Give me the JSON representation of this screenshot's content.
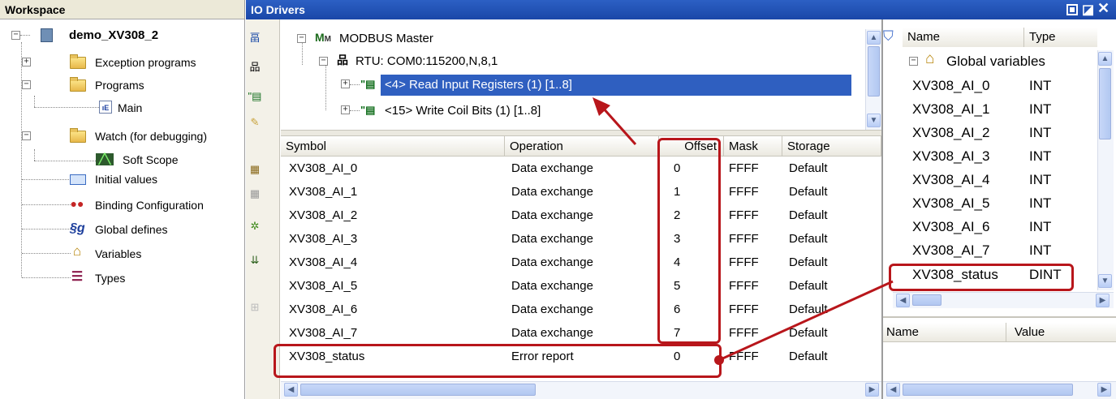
{
  "workspace": {
    "title": "Workspace",
    "root": "demo_XV308_2",
    "items": [
      {
        "label": "Exception programs"
      },
      {
        "label": "Programs"
      },
      {
        "label": "Main"
      },
      {
        "label": "Watch (for debugging)"
      },
      {
        "label": "Soft Scope"
      },
      {
        "label": "Initial values"
      },
      {
        "label": "Binding Configuration"
      },
      {
        "label": "Global defines"
      },
      {
        "label": "Variables"
      },
      {
        "label": "Types"
      }
    ]
  },
  "io": {
    "title": "IO Drivers",
    "tree": {
      "master": "MODBUS Master",
      "rtu": "RTU: COM0:115200,N,8,1",
      "read": "<4> Read Input Registers (1) [1..8]",
      "write": "<15> Write Coil Bits (1) [1..8]"
    },
    "columns": [
      "Symbol",
      "Operation",
      "Offset",
      "Mask",
      "Storage"
    ],
    "rows": [
      {
        "symbol": "XV308_AI_0",
        "operation": "Data exchange",
        "offset": "0",
        "mask": "FFFF",
        "storage": "Default"
      },
      {
        "symbol": "XV308_AI_1",
        "operation": "Data exchange",
        "offset": "1",
        "mask": "FFFF",
        "storage": "Default"
      },
      {
        "symbol": "XV308_AI_2",
        "operation": "Data exchange",
        "offset": "2",
        "mask": "FFFF",
        "storage": "Default"
      },
      {
        "symbol": "XV308_AI_3",
        "operation": "Data exchange",
        "offset": "3",
        "mask": "FFFF",
        "storage": "Default"
      },
      {
        "symbol": "XV308_AI_4",
        "operation": "Data exchange",
        "offset": "4",
        "mask": "FFFF",
        "storage": "Default"
      },
      {
        "symbol": "XV308_AI_5",
        "operation": "Data exchange",
        "offset": "5",
        "mask": "FFFF",
        "storage": "Default"
      },
      {
        "symbol": "XV308_AI_6",
        "operation": "Data exchange",
        "offset": "6",
        "mask": "FFFF",
        "storage": "Default"
      },
      {
        "symbol": "XV308_AI_7",
        "operation": "Data exchange",
        "offset": "7",
        "mask": "FFFF",
        "storage": "Default"
      },
      {
        "symbol": "XV308_status",
        "operation": "Error report",
        "offset": "0",
        "mask": "FFFF",
        "storage": "Default"
      }
    ]
  },
  "vars": {
    "col_name": "Name",
    "col_type": "Type",
    "group": "Global variables",
    "rows": [
      {
        "name": "XV308_AI_0",
        "type": "INT"
      },
      {
        "name": "XV308_AI_1",
        "type": "INT"
      },
      {
        "name": "XV308_AI_2",
        "type": "INT"
      },
      {
        "name": "XV308_AI_3",
        "type": "INT"
      },
      {
        "name": "XV308_AI_4",
        "type": "INT"
      },
      {
        "name": "XV308_AI_5",
        "type": "INT"
      },
      {
        "name": "XV308_AI_6",
        "type": "INT"
      },
      {
        "name": "XV308_AI_7",
        "type": "INT"
      },
      {
        "name": "XV308_status",
        "type": "DINT"
      }
    ],
    "props_name": "Name",
    "props_value": "Value"
  },
  "colors": {
    "titlebar": "#1f4fb4",
    "selection": "#2f5fc0",
    "highlight": "#b8161b"
  }
}
